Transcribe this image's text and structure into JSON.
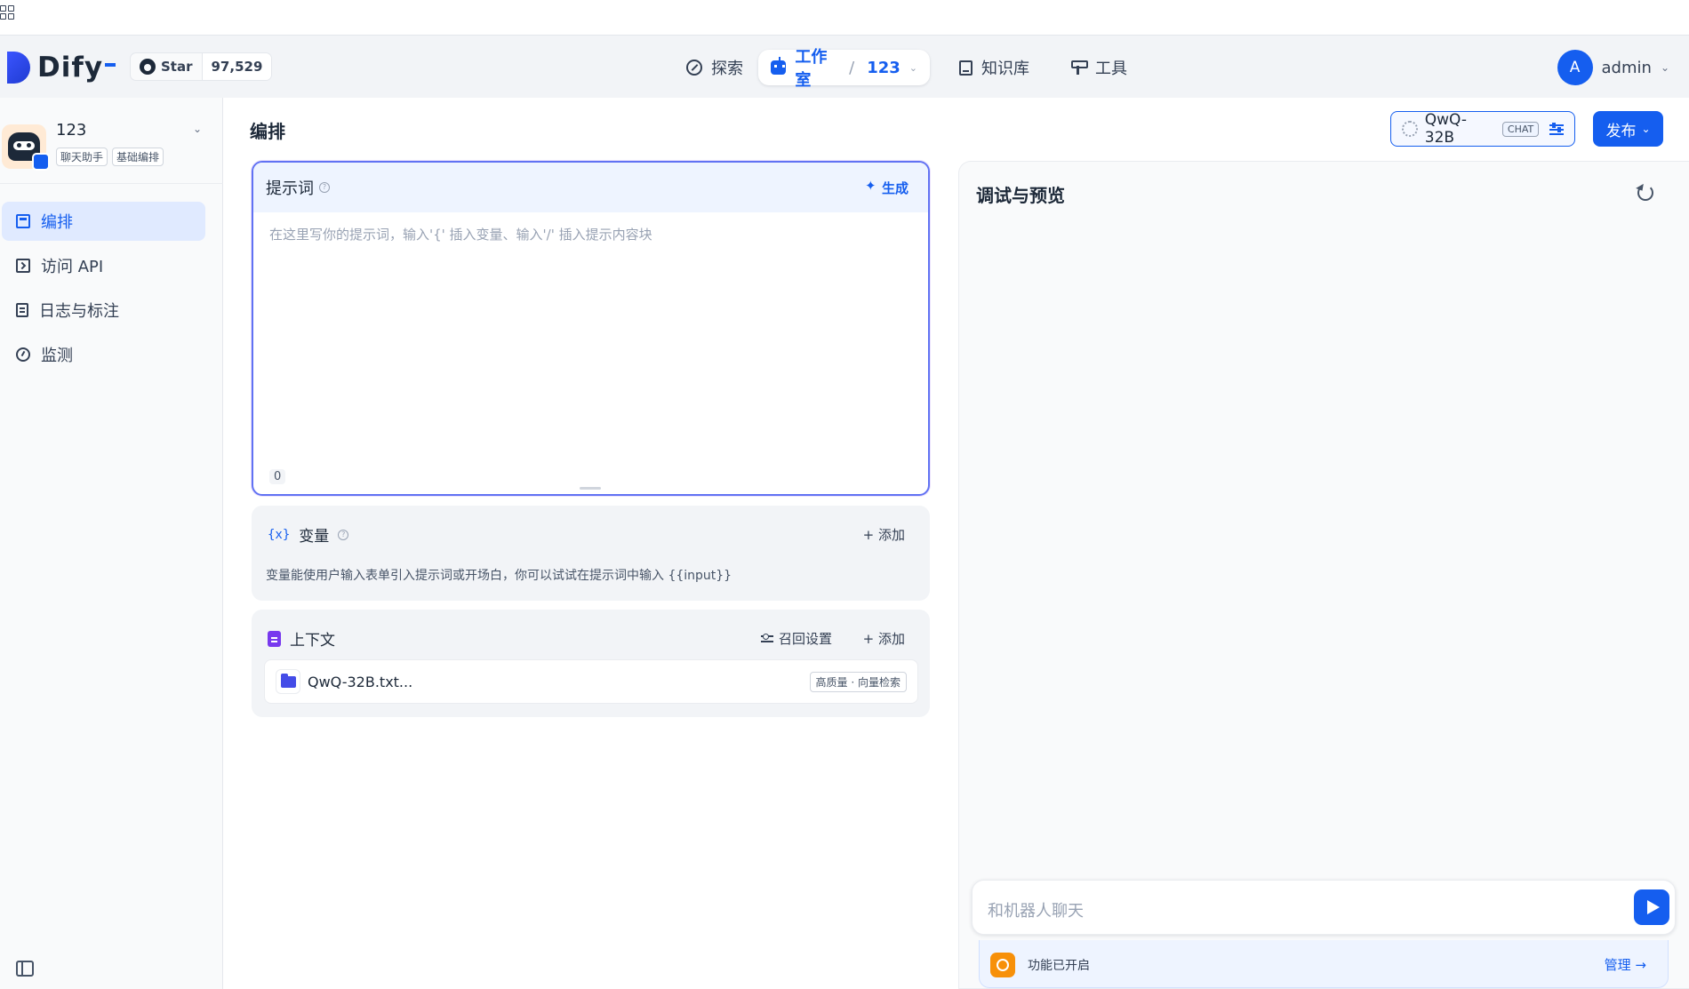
{
  "browser": {
    "grid_icon": "grid-icon"
  },
  "header": {
    "logo_text": "Dify",
    "github": {
      "label": "Star",
      "count": "97,529"
    },
    "nav": {
      "explore": "探索",
      "studio": "工作室",
      "studio_separator": "/",
      "studio_app": "123",
      "knowledge": "知识库",
      "tools": "工具"
    },
    "user": {
      "initial": "A",
      "name": "admin"
    }
  },
  "sidebar": {
    "app_name": "123",
    "app_tags": [
      "聊天助手",
      "基础编排"
    ],
    "items": [
      {
        "label": "编排",
        "icon": "layout-icon",
        "active": true
      },
      {
        "label": "访问 API",
        "icon": "terminal-icon",
        "active": false
      },
      {
        "label": "日志与标注",
        "icon": "file-list-icon",
        "active": false
      },
      {
        "label": "监测",
        "icon": "gauge-icon",
        "active": false
      }
    ]
  },
  "main": {
    "title": "编排",
    "model": {
      "name": "QwQ-32B",
      "mode": "CHAT"
    },
    "publish_label": "发布",
    "prompt": {
      "title": "提示词",
      "generate_label": "生成",
      "placeholder": "在这里写你的提示词，输入'{' 插入变量、输入'/' 插入提示内容块",
      "char_count": "0"
    },
    "variables": {
      "icon_text": "{x}",
      "title": "变量",
      "add_label": "+ 添加",
      "description": "变量能使用户输入表单引入提示词或开场白，你可以试试在提示词中输入 {{input}}"
    },
    "context": {
      "title": "上下文",
      "recall_label": "召回设置",
      "add_label": "+ 添加",
      "dataset_name": "QwQ-32B.txt...",
      "dataset_tag": "高质量 · 向量检索"
    }
  },
  "debug": {
    "title": "调试与预览",
    "chat_placeholder": "和机器人聊天",
    "feature_text": "功能已开启",
    "manage_label": "管理 →"
  },
  "colors": {
    "accent": "#155eef",
    "prompt_border": "#6172f3",
    "context_icon": "#7839ee",
    "feature_icon": "#f79009"
  }
}
